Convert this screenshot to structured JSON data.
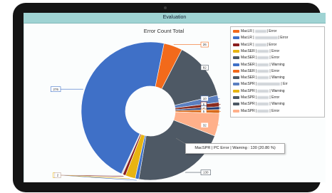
{
  "window": {
    "title": "Evaluation"
  },
  "chart_data": {
    "type": "pie",
    "title": "Error Count Total",
    "hole": "donut",
    "slices": [
      {
        "value": 26,
        "label": "26",
        "color": "#f26a1b"
      },
      {
        "value": 82,
        "label": "82",
        "color": "#4e5965"
      },
      {
        "value": 10,
        "label": "10",
        "color": "#5b7fc0"
      },
      {
        "value": 6,
        "label": "6",
        "color": "#8a2b1f"
      },
      {
        "value": 4,
        "label": "4",
        "color": "#1e3c78"
      },
      {
        "value": 5,
        "label": "5",
        "color": "#d96b1a"
      },
      {
        "value": 32,
        "label": "32",
        "color": "#ffb08a"
      },
      {
        "value": 130,
        "label": "130",
        "color": "#4e5965"
      },
      {
        "value": 5,
        "label": "5",
        "color": "#3f70c7"
      },
      {
        "value": 14,
        "label": "14",
        "color": "#e8b412"
      },
      {
        "value": 4,
        "label": "4",
        "color": "#8a1e1e"
      },
      {
        "value": 2,
        "label": "2",
        "color": "#dcdcdc"
      },
      {
        "value": 276,
        "label": "276",
        "color": "#3f70c7"
      }
    ]
  },
  "legend": {
    "items": [
      {
        "prefix": "MacLR |",
        "suffix": "| Error",
        "long": false,
        "color": "#f26a1b"
      },
      {
        "prefix": "MacLR |",
        "suffix": "| Error",
        "long": true,
        "color": "#3f70c7"
      },
      {
        "prefix": "MacLR |",
        "suffix": "| Error",
        "long": false,
        "color": "#8a1e1e"
      },
      {
        "prefix": "MacSER |",
        "suffix": "| Error",
        "long": false,
        "color": "#e8b412"
      },
      {
        "prefix": "MacSER |",
        "suffix": "| Error",
        "long": false,
        "color": "#4e5965"
      },
      {
        "prefix": "MacSER |",
        "suffix": "| Warning",
        "long": false,
        "color": "#3f70c7"
      },
      {
        "prefix": "MacSER |",
        "suffix": "| Error",
        "long": false,
        "color": "#f26a1b"
      },
      {
        "prefix": "MacSER |",
        "suffix": "| Warning",
        "long": false,
        "color": "#4e5965"
      },
      {
        "prefix": "MacSPR |",
        "suffix": "| Err",
        "long": true,
        "color": "#5b7fc0"
      },
      {
        "prefix": "MacSPR |",
        "suffix": "| Warning",
        "long": false,
        "color": "#e8b412"
      },
      {
        "prefix": "MacSPR |",
        "suffix": "| Error",
        "long": false,
        "color": "#4e5965"
      },
      {
        "prefix": "MacSPR |",
        "suffix": "| Warning",
        "long": false,
        "color": "#4e5965"
      },
      {
        "prefix": "MacSPR |",
        "suffix": "| Error",
        "long": false,
        "color": "#ffb08a"
      }
    ]
  },
  "tooltip": {
    "text": "MacSPR | PC Error | Warning : 130 (20.80 %)"
  }
}
